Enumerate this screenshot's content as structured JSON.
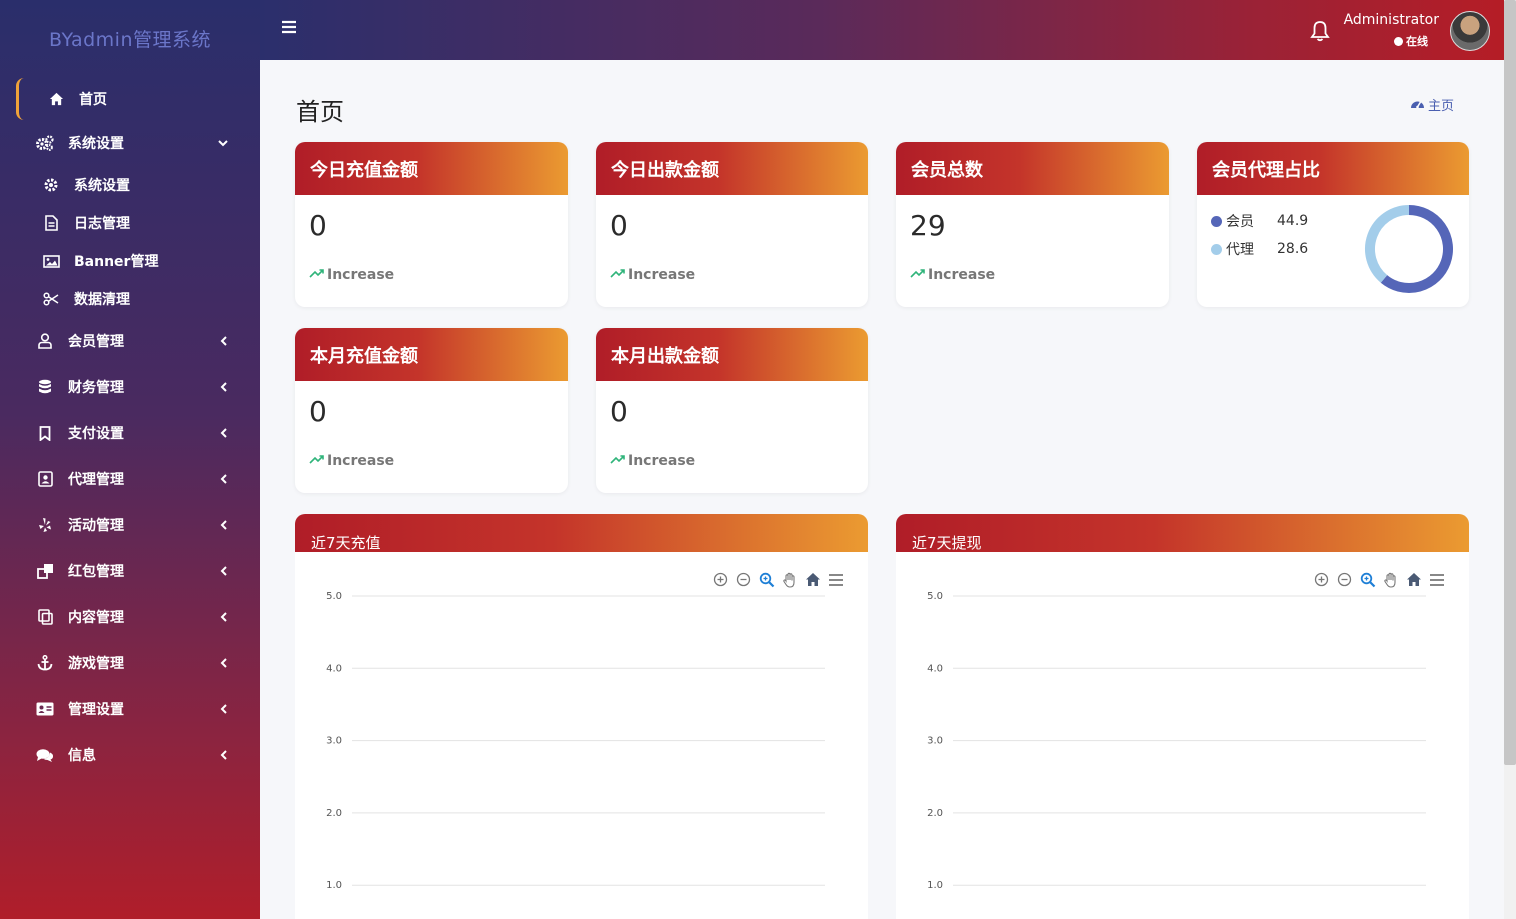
{
  "brand": "BYadmin管理系统",
  "nav": {
    "home": "首页",
    "system": {
      "label": "系统设置",
      "children": [
        "系统设置",
        "日志管理",
        "Banner管理",
        "数据清理"
      ]
    },
    "items": [
      "会员管理",
      "财务管理",
      "支付设置",
      "代理管理",
      "活动管理",
      "红包管理",
      "内容管理",
      "游戏管理",
      "管理设置",
      "信息"
    ]
  },
  "topbar": {
    "admin": "Administrator",
    "status": "在线"
  },
  "page": {
    "title": "首页",
    "breadcrumb": "主页"
  },
  "stats": [
    {
      "title": "今日充值金额",
      "value": "0",
      "trend": "Increase"
    },
    {
      "title": "今日出款金额",
      "value": "0",
      "trend": "Increase"
    },
    {
      "title": "会员总数",
      "value": "29",
      "trend": "Increase"
    },
    {
      "title": "本月充值金额",
      "value": "0",
      "trend": "Increase"
    },
    {
      "title": "本月出款金额",
      "value": "0",
      "trend": "Increase"
    }
  ],
  "ratio": {
    "title": "会员代理占比",
    "colors": {
      "member": "#5566b8",
      "agent": "#a3cdea"
    }
  },
  "chart_data": [
    {
      "type": "line",
      "title": "近7天充值",
      "ylim": [
        0,
        5
      ],
      "yticks": [
        "5.0",
        "4.0",
        "3.0",
        "2.0",
        "1.0"
      ],
      "series": [],
      "grid": true
    },
    {
      "type": "line",
      "title": "近7天提现",
      "ylim": [
        0,
        5
      ],
      "yticks": [
        "5.0",
        "4.0",
        "3.0",
        "2.0",
        "1.0"
      ],
      "series": [],
      "grid": true
    },
    {
      "type": "pie",
      "title": "会员代理占比",
      "categories": [
        "会员",
        "代理"
      ],
      "values": [
        44.9,
        28.6
      ],
      "legend": "left"
    }
  ]
}
